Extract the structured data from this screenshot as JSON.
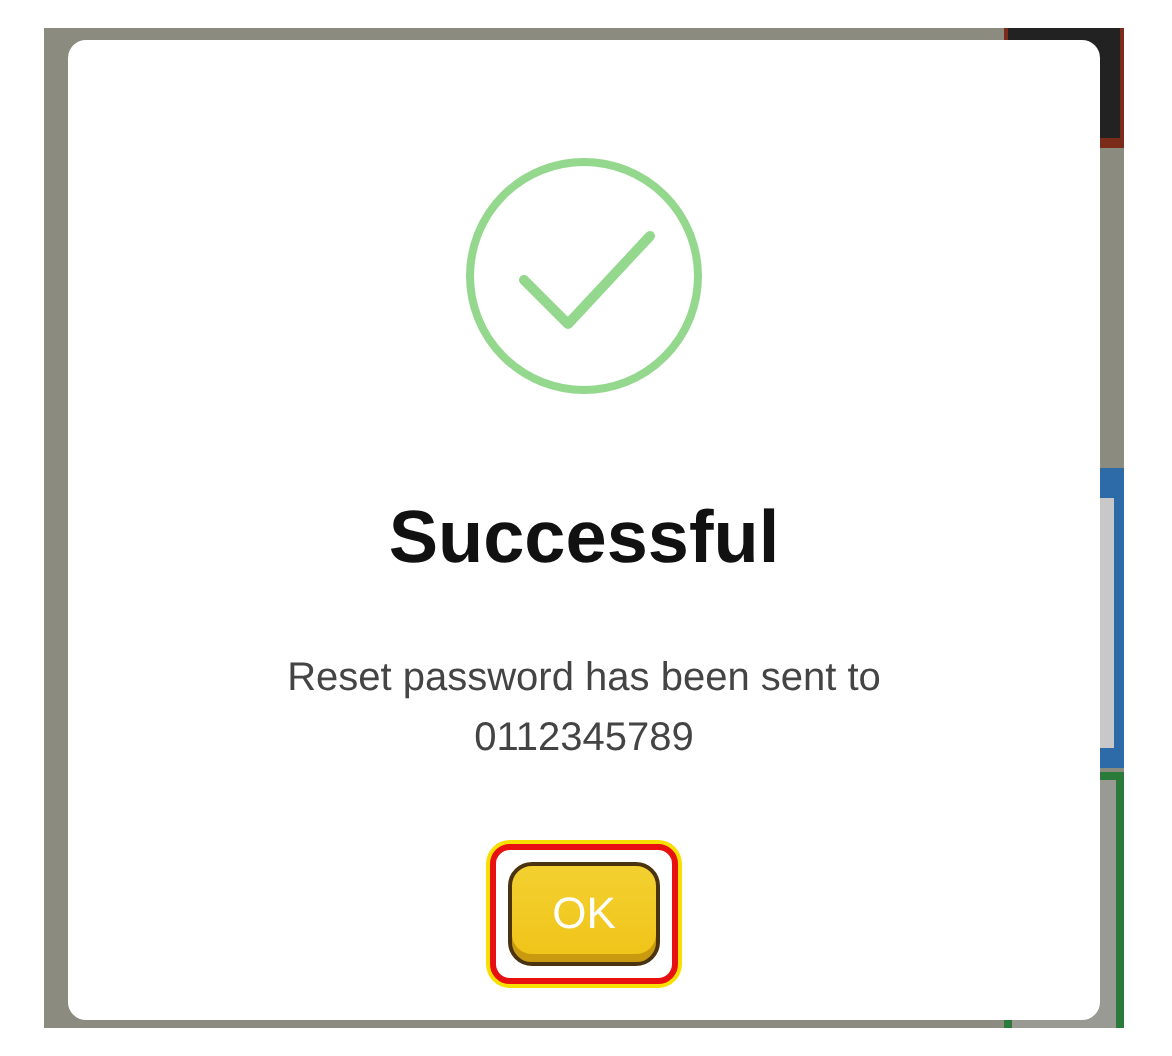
{
  "dialog": {
    "kind": "success",
    "title": "Successful",
    "message": "Reset password has been sent to 0112345789",
    "buttons": [
      {
        "label": "OK",
        "selected": true
      }
    ]
  }
}
